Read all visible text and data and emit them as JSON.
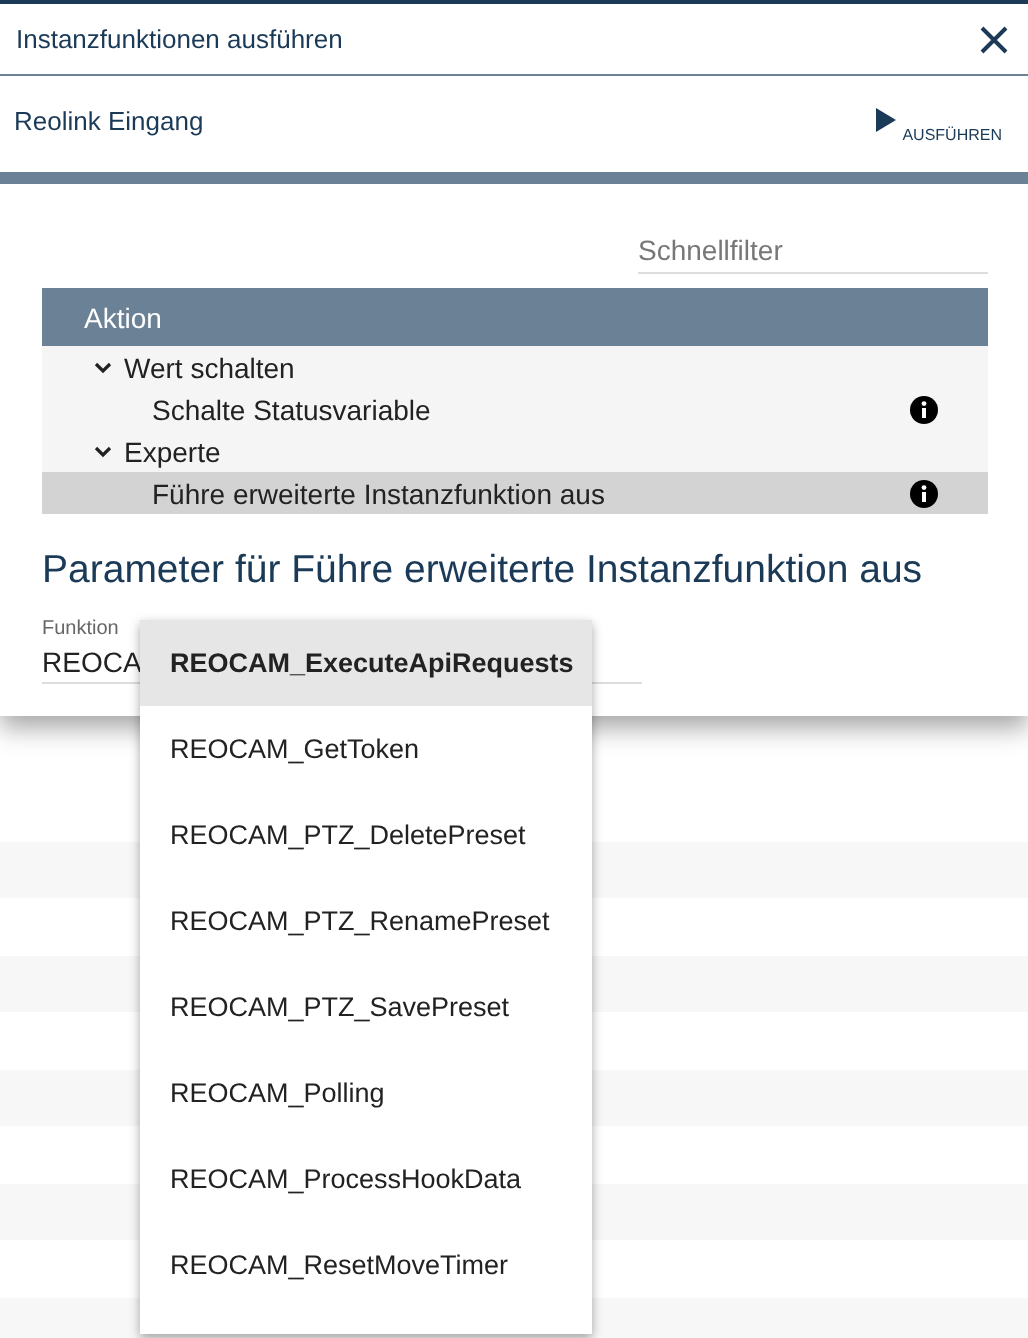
{
  "window": {
    "title": "Instanzfunktionen ausführen"
  },
  "toolbar": {
    "instance": "Reolink Eingang",
    "run_button": "AUSFÜHREN"
  },
  "filter": {
    "placeholder": "Schnellfilter"
  },
  "table": {
    "column": "Aktion",
    "groups": [
      {
        "label": "Wert schalten",
        "expanded": true,
        "children": [
          {
            "label": "Schalte Statusvariable",
            "selected": false
          }
        ]
      },
      {
        "label": "Experte",
        "expanded": true,
        "children": [
          {
            "label": "Führe erweiterte Instanzfunktion aus",
            "selected": true
          }
        ]
      }
    ]
  },
  "parameters": {
    "heading": "Parameter für Führe erweiterte Instanzfunktion aus",
    "field_label": "Funktion",
    "field_value": "REOCA"
  },
  "dropdown": {
    "options": [
      {
        "label": "REOCAM_ExecuteApiRequests",
        "selected": true
      },
      {
        "label": "REOCAM_GetToken",
        "selected": false
      },
      {
        "label": "REOCAM_PTZ_DeletePreset",
        "selected": false
      },
      {
        "label": "REOCAM_PTZ_RenamePreset",
        "selected": false
      },
      {
        "label": "REOCAM_PTZ_SavePreset",
        "selected": false
      },
      {
        "label": "REOCAM_Polling",
        "selected": false
      },
      {
        "label": "REOCAM_ProcessHookData",
        "selected": false
      },
      {
        "label": "REOCAM_ResetMoveTimer",
        "selected": false
      }
    ]
  }
}
